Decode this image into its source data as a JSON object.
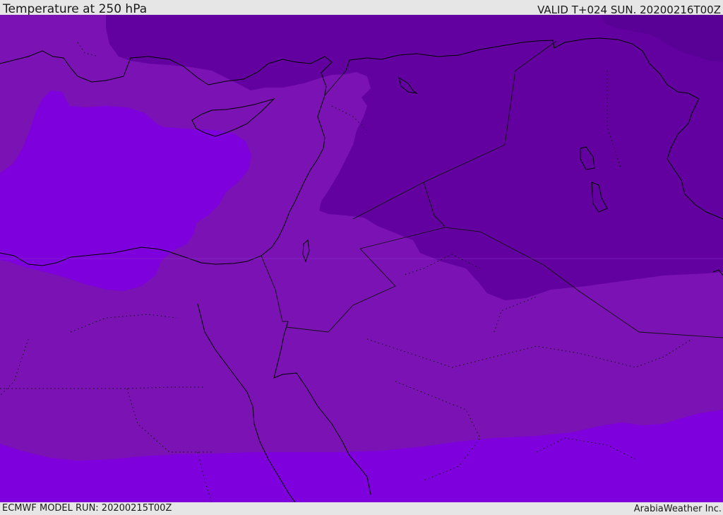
{
  "header": {
    "title": "Temperature at 250 hPa",
    "valid_time": "VALID T+024 SUN. 20200216T00Z"
  },
  "footer": {
    "model_run": "ECMWF MODEL RUN: 20200215T00Z",
    "credit": "ArabiaWeather Inc."
  },
  "map": {
    "region": "Eastern Mediterranean, Egypt, Levant, Iraq, northern Arabia",
    "field": "temperature",
    "level": "250 hPa",
    "colors": {
      "band_coldest": "#590096",
      "band_cold": "#6200a0",
      "band_mid": "#7a12b4",
      "band_warm": "#7e00dc",
      "coastline": "#000000",
      "border": "#1a1a1a"
    }
  }
}
